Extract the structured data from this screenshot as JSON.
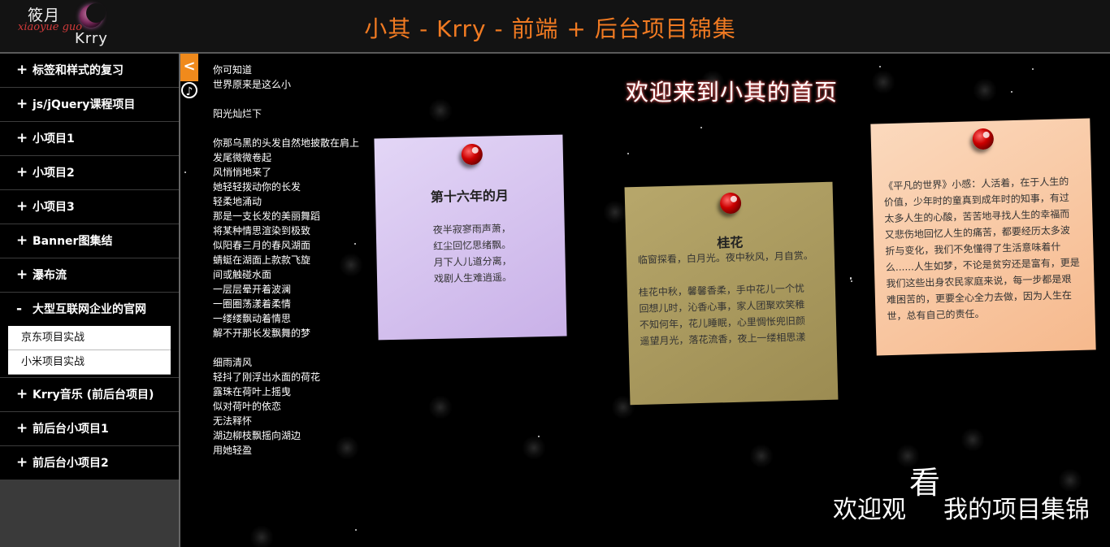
{
  "header": {
    "logo_top": "筱月",
    "logo_script": "xiaoyue guo",
    "logo_name": "Krry",
    "title": "小其 - Krry - 前端 + 后台项目锦集"
  },
  "sidebar": {
    "items": [
      {
        "sign": "+",
        "label": "标签和样式的复习"
      },
      {
        "sign": "+",
        "label": "js/jQuery课程项目"
      },
      {
        "sign": "+",
        "label": "小项目1"
      },
      {
        "sign": "+",
        "label": "小项目2"
      },
      {
        "sign": "+",
        "label": "小项目3"
      },
      {
        "sign": "+",
        "label": "Banner图集结"
      },
      {
        "sign": "+",
        "label": "瀑布流"
      },
      {
        "sign": "-",
        "label": "大型互联网企业的官网"
      },
      {
        "sign": "+",
        "label": "Krry音乐 (前后台项目)"
      },
      {
        "sign": "+",
        "label": "前后台小项目1"
      },
      {
        "sign": "+",
        "label": "前后台小项目2"
      }
    ],
    "expanded_sub": [
      "京东项目实战",
      "小米项目实战"
    ]
  },
  "controls": {
    "toggle": "<",
    "music": "♪"
  },
  "poem": [
    "你可知道",
    "世界原来是这么小",
    "",
    "阳光灿烂下",
    "",
    "你那乌黑的头发自然地披散在肩上",
    "发尾微微卷起",
    "风悄悄地来了",
    "她轻轻拨动你的长发",
    "轻柔地涌动",
    "那是一支长发的美丽舞蹈",
    "将某种情思渲染到极致",
    "似阳春三月的春风湖面",
    "蜻蜓在湖面上款款飞旋",
    "间或触碰水面",
    "一层层晕开着波澜",
    "一圈圈荡漾着柔情",
    "一缕缕飘动着情思",
    "解不开那长发飘舞的梦",
    "",
    "细雨清风",
    "轻抖了刚浮出水面的荷花",
    "露珠在荷叶上摇曳",
    "似对荷叶的依恋",
    "无法释怀",
    "湖边柳枝飘摇向湖边",
    "用她轻盈"
  ],
  "welcome": "欢迎来到小其的首页",
  "notes": [
    {
      "title": "第十六年的月",
      "lines": [
        "夜半寂寥雨声萧，",
        "红尘回忆思绪飘。",
        "月下人儿道分离，",
        "戏剧人生难逍遥。"
      ]
    },
    {
      "title": "桂花",
      "lines": [
        "临窗探看，白月光。夜中秋风，月自赏。",
        "",
        "桂花中秋，馨馨香柔，手中花儿一个忧",
        "回想儿时，沁香心事，家人团聚欢笑稚",
        "不知何年，花儿睡眠，心里惆怅兜旧颜",
        "遥望月光，落花流香，夜上一缕相思漾"
      ]
    },
    {
      "title": "",
      "lines": [
        "《平凡的世界》小感：人活着，在于人生的",
        "价值，少年时的童真到成年时的知事，有过",
        "太多人生的心酸，苦苦地寻找人生的幸福而",
        "又悲伤地回忆人生的痛苦，都要经历太多波",
        "折与变化，我们不免懂得了生活意味着什",
        "么......人生如梦，不论是贫穷还是富有，更是",
        "我们这些出身农民家庭来说，每一步都是艰",
        "难困苦的，更要全心全力去做，因为人生在",
        "世，总有自己的责任。"
      ]
    }
  ],
  "footer": {
    "pre": "欢迎观",
    "big": "看",
    "post": "我的项目集锦"
  }
}
